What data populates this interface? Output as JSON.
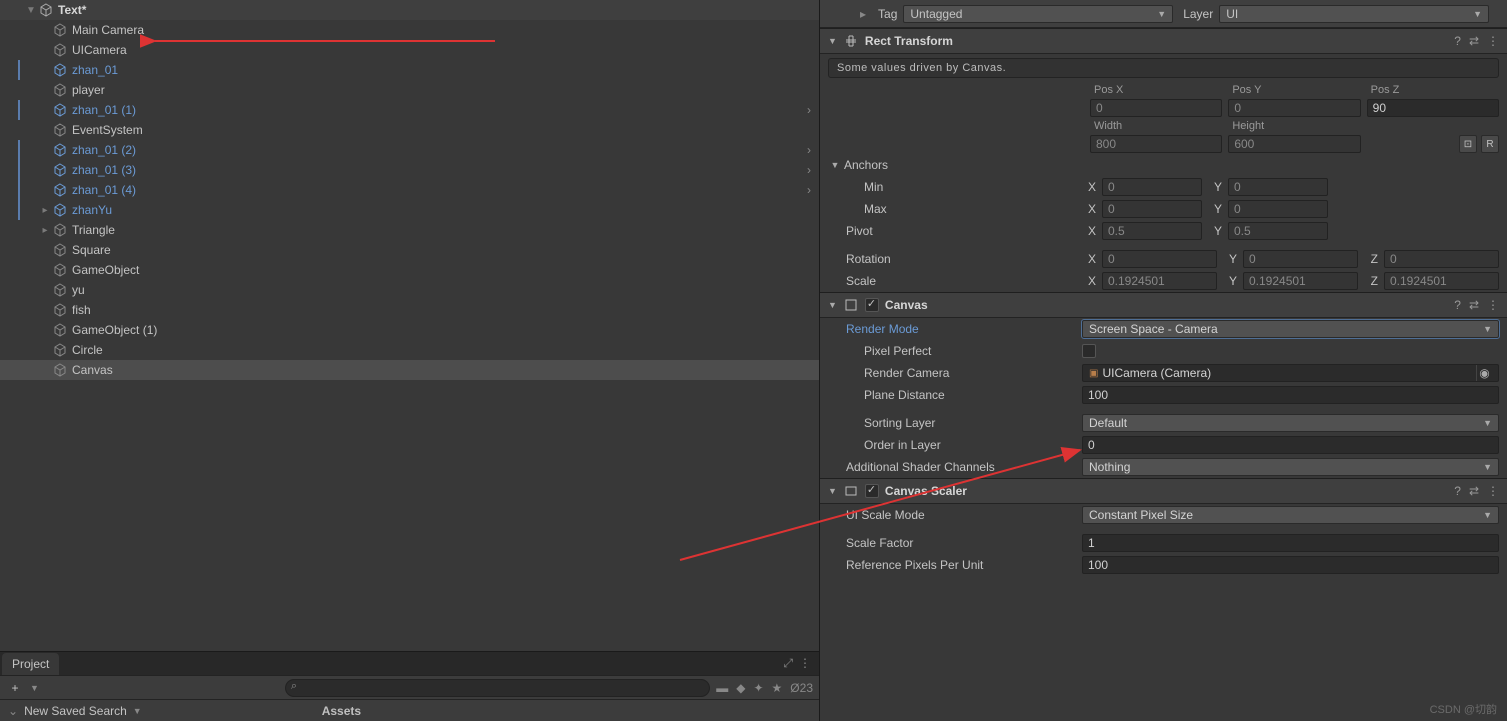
{
  "hierarchy": {
    "top_item": "Text*",
    "items": [
      {
        "label": "Main Camera",
        "prefab": false,
        "indent": 52
      },
      {
        "label": "UICamera",
        "prefab": false,
        "indent": 52
      },
      {
        "label": "zhan_01",
        "prefab": true,
        "indent": 52,
        "bar": true
      },
      {
        "label": "player",
        "prefab": false,
        "indent": 52
      },
      {
        "label": "zhan_01 (1)",
        "prefab": true,
        "indent": 52,
        "chev": true,
        "bar": true
      },
      {
        "label": "EventSystem",
        "prefab": false,
        "indent": 52
      },
      {
        "label": "zhan_01 (2)",
        "prefab": true,
        "indent": 52,
        "chev": true,
        "bar": true
      },
      {
        "label": "zhan_01 (3)",
        "prefab": true,
        "indent": 52,
        "chev": true,
        "bar": true
      },
      {
        "label": "zhan_01 (4)",
        "prefab": true,
        "indent": 52,
        "chev": true,
        "bar": true
      },
      {
        "label": "zhanYu",
        "prefab": true,
        "indent": 38,
        "fold": true,
        "bar": true
      },
      {
        "label": "Triangle",
        "prefab": false,
        "indent": 38,
        "fold": true
      },
      {
        "label": "Square",
        "prefab": false,
        "indent": 52
      },
      {
        "label": "GameObject",
        "prefab": false,
        "indent": 52
      },
      {
        "label": "yu",
        "prefab": false,
        "indent": 52
      },
      {
        "label": "fish",
        "prefab": false,
        "indent": 52
      },
      {
        "label": "GameObject (1)",
        "prefab": false,
        "indent": 52
      },
      {
        "label": "Circle",
        "prefab": false,
        "indent": 52
      },
      {
        "label": "Canvas",
        "prefab": false,
        "indent": 52,
        "selected": true
      }
    ]
  },
  "project": {
    "tab": "Project",
    "saved_search_label": "New Saved Search",
    "assets_label": "Assets",
    "visibility_count": "23"
  },
  "tagLayer": {
    "tag_label": "Tag",
    "tag_value": "Untagged",
    "layer_label": "Layer",
    "layer_value": "UI"
  },
  "rectTransform": {
    "title": "Rect Transform",
    "info": "Some values driven by Canvas.",
    "pos_labels": {
      "x": "Pos X",
      "y": "Pos Y",
      "z": "Pos Z"
    },
    "pos": {
      "x": "0",
      "y": "0",
      "z": "90"
    },
    "size_labels": {
      "w": "Width",
      "h": "Height"
    },
    "size": {
      "w": "800",
      "h": "600"
    },
    "anchors_label": "Anchors",
    "anchors_min_label": "Min",
    "anchors_max_label": "Max",
    "anchors_min": {
      "x": "0",
      "y": "0"
    },
    "anchors_max": {
      "x": "0",
      "y": "0"
    },
    "pivot_label": "Pivot",
    "pivot": {
      "x": "0.5",
      "y": "0.5"
    },
    "rotation_label": "Rotation",
    "rotation": {
      "x": "0",
      "y": "0",
      "z": "0"
    },
    "scale_label": "Scale",
    "scale": {
      "x": "0.1924501",
      "y": "0.1924501",
      "z": "0.1924501"
    }
  },
  "canvas": {
    "title": "Canvas",
    "render_mode_label": "Render Mode",
    "render_mode_value": "Screen Space - Camera",
    "pixel_perfect_label": "Pixel Perfect",
    "render_camera_label": "Render Camera",
    "render_camera_value": "UICamera (Camera)",
    "plane_distance_label": "Plane Distance",
    "plane_distance_value": "100",
    "sorting_layer_label": "Sorting Layer",
    "sorting_layer_value": "Default",
    "order_in_layer_label": "Order in Layer",
    "order_in_layer_value": "0",
    "additional_shader_label": "Additional Shader Channels",
    "additional_shader_value": "Nothing"
  },
  "canvasScaler": {
    "title": "Canvas Scaler",
    "ui_scale_mode_label": "UI Scale Mode",
    "ui_scale_mode_value": "Constant Pixel Size",
    "scale_factor_label": "Scale Factor",
    "scale_factor_value": "1",
    "ref_ppu_label": "Reference Pixels Per Unit",
    "ref_ppu_value": "100"
  },
  "watermark": "CSDN @切韵"
}
